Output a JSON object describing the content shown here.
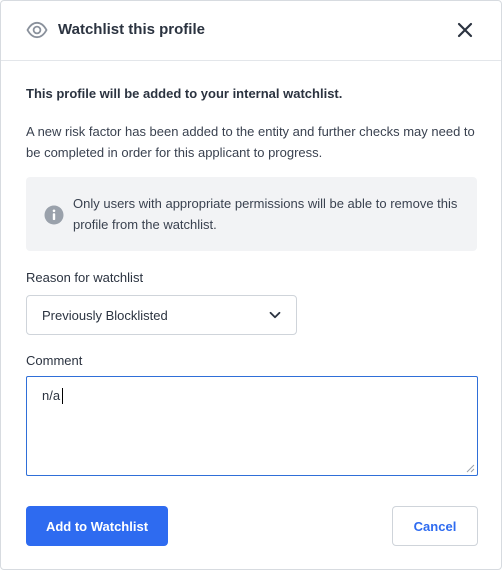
{
  "modal": {
    "title": "Watchlist this profile",
    "title_icon": "eye-icon",
    "close_icon": "close-icon"
  },
  "body": {
    "heading": "This profile will be added to your internal watchlist.",
    "description": "A new risk factor has been added to the entity and further checks may need to be completed in order for this applicant to progress.",
    "info": {
      "icon": "info-icon",
      "text": "Only users with appropriate permissions will be able to remove this profile from the watchlist."
    }
  },
  "form": {
    "reason_label": "Reason for watchlist",
    "reason_selected": "Previously Blocklisted",
    "comment_label": "Comment",
    "comment_value": "n/a"
  },
  "actions": {
    "primary_label": "Add to Watchlist",
    "secondary_label": "Cancel"
  },
  "colors": {
    "primary": "#2e6bf0",
    "focus_border": "#2f6fd8",
    "info_bg": "#f2f3f5"
  }
}
